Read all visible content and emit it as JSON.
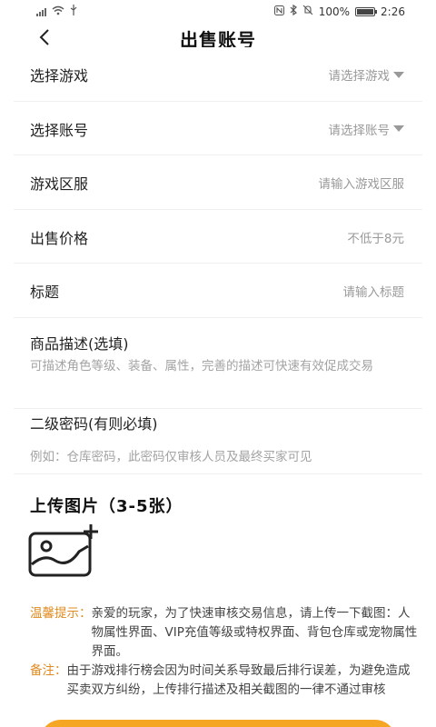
{
  "status_bar": {
    "battery": "100%",
    "time": "2:26"
  },
  "nav": {
    "title": "出售账号"
  },
  "form": {
    "game": {
      "label": "选择游戏",
      "placeholder": "请选择游戏"
    },
    "account": {
      "label": "选择账号",
      "placeholder": "请选择账号"
    },
    "server": {
      "label": "游戏区服",
      "placeholder": "请输入游戏区服"
    },
    "price": {
      "label": "出售价格",
      "placeholder": "不低于8元"
    },
    "title": {
      "label": "标题",
      "placeholder": "请输入标题"
    },
    "description": {
      "label": "商品描述(选填)",
      "placeholder": "可描述角色等级、装备、属性，完善的描述可快速有效促成交易"
    },
    "password": {
      "label": "二级密码(有则必填)",
      "placeholder": "例如：仓库密码，此密码仅审核人员及最终买家可见"
    }
  },
  "upload": {
    "title": "上传图片（3-5张）"
  },
  "tips": {
    "reminder_label": "温馨提示：",
    "reminder_text": "亲爱的玩家，为了快速审核交易信息，请上传一下截图：人物属性界面、VIP充值等级或特权界面、背包仓库或宠物属性界面。",
    "note_label": "备注：",
    "note_text": "由于游戏排行榜会因为时间关系导致最后排行误差，为避免造成买卖双方纠纷，上传排行描述及相关截图的一律不通过审核"
  },
  "colors": {
    "accent": "#f5a623",
    "tip_label": "#e08a1e",
    "placeholder": "#9a9a9a"
  }
}
